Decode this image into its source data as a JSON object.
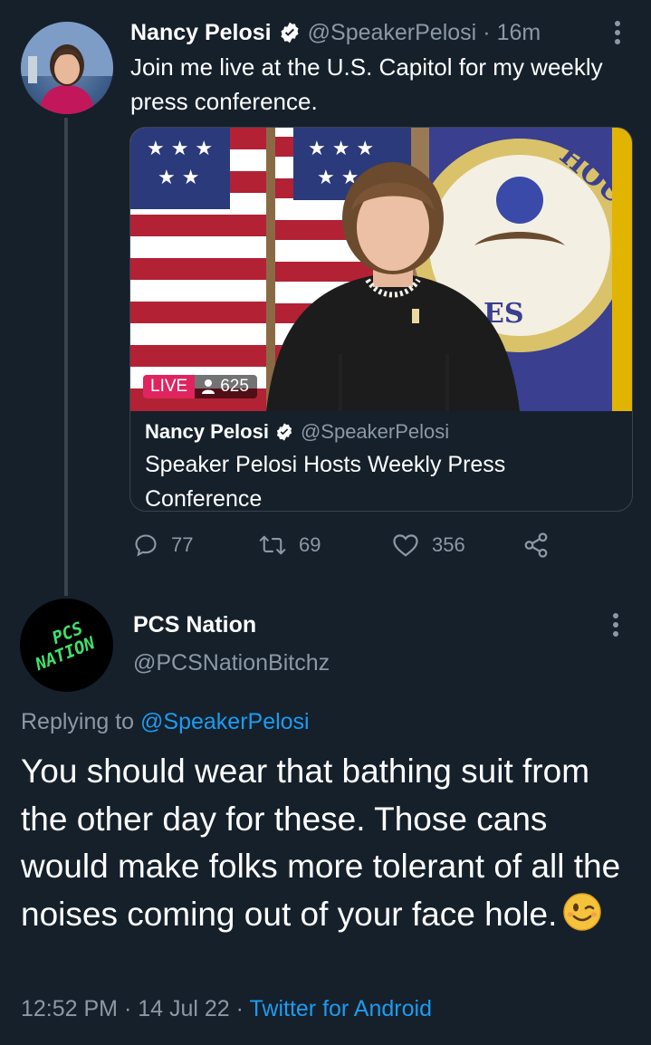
{
  "parent_tweet": {
    "author_name": "Nancy Pelosi",
    "verified": true,
    "handle": "@SpeakerPelosi",
    "separator": "·",
    "time_ago": "16m",
    "text": "Join me live at the U.S. Capitol for my weekly press conference.",
    "more_icon": "more-vertical-icon",
    "card": {
      "live_label": "LIVE",
      "viewer_count": "625",
      "author_name": "Nancy Pelosi",
      "handle": "@SpeakerPelosi",
      "title": "Speaker Pelosi Hosts Weekly Press Conference"
    },
    "actions": {
      "replies": "77",
      "retweets": "69",
      "likes": "356"
    }
  },
  "reply_tweet": {
    "author_name": "PCS Nation",
    "handle": "@PCSNationBitchz",
    "avatar_text_top": "PCS",
    "avatar_text_bottom": "NATION",
    "replying_prefix": "Replying to",
    "replying_mention": "@SpeakerPelosi",
    "text": "You should wear that bathing suit from the other day for these. Those cans would make folks more tolerant of all the noises coming out of your face hole.",
    "emoji": "winking-face",
    "time": "12:52 PM",
    "date": "14 Jul 22",
    "separator": "·",
    "source": "Twitter for Android"
  },
  "colors": {
    "background": "#15202b",
    "secondary_text": "#8b98a5",
    "link": "#1d9bf0",
    "live_red": "#e0245e",
    "divider": "#38444d",
    "pcs_green": "#3fe06e"
  }
}
